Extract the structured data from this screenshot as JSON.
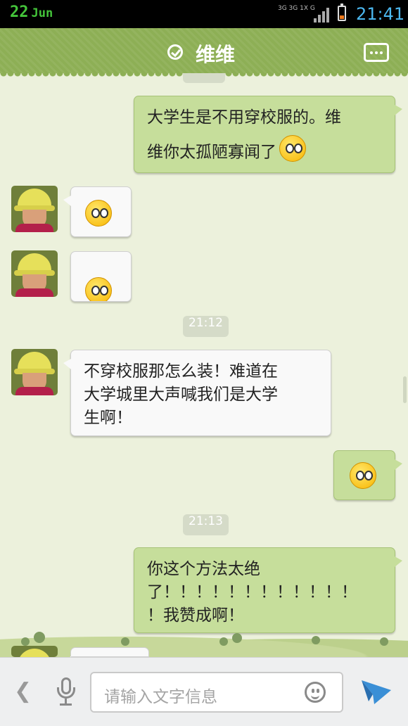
{
  "status_bar": {
    "day": "22",
    "month": "Jun",
    "network_top": "3G 3G 1X G",
    "time": "21:41",
    "battery_color": "#f07a1c"
  },
  "header": {
    "title": "维维",
    "status_icon": "check-circle-icon",
    "menu_icon": "more-icon",
    "bg_color": "#8daf55"
  },
  "messages": [
    {
      "side": "out",
      "text_line1": "大学生是不用穿校服的。维",
      "text_line2": "维你太孤陋寡闻了",
      "emoji": "tongue-wink-emoji"
    },
    {
      "side": "in",
      "emoji": "rolling-eyes-emoji"
    },
    {
      "side": "in",
      "emoji": "peeking-emoji"
    },
    {
      "side": "time",
      "text": "21:12"
    },
    {
      "side": "in",
      "text_line1": "不穿校服那怎么装！难道在",
      "text_line2": "大学城里大声喊我们是大学",
      "text_line3": "生啊！"
    },
    {
      "side": "out",
      "emoji": "squint-emoji"
    },
    {
      "side": "time",
      "text": "21:13"
    },
    {
      "side": "out",
      "text_line1": "你这个方法太绝",
      "text_line2": "了！！！！！！！！！！！！",
      "text_line3": "！我赞成啊！"
    }
  ],
  "input_bar": {
    "placeholder": "请输入文字信息",
    "back_icon": "chevron-left-icon",
    "mic_icon": "microphone-icon",
    "emoji_icon": "smiley-icon",
    "send_icon": "send-icon",
    "send_color": "#3a8fd6"
  }
}
